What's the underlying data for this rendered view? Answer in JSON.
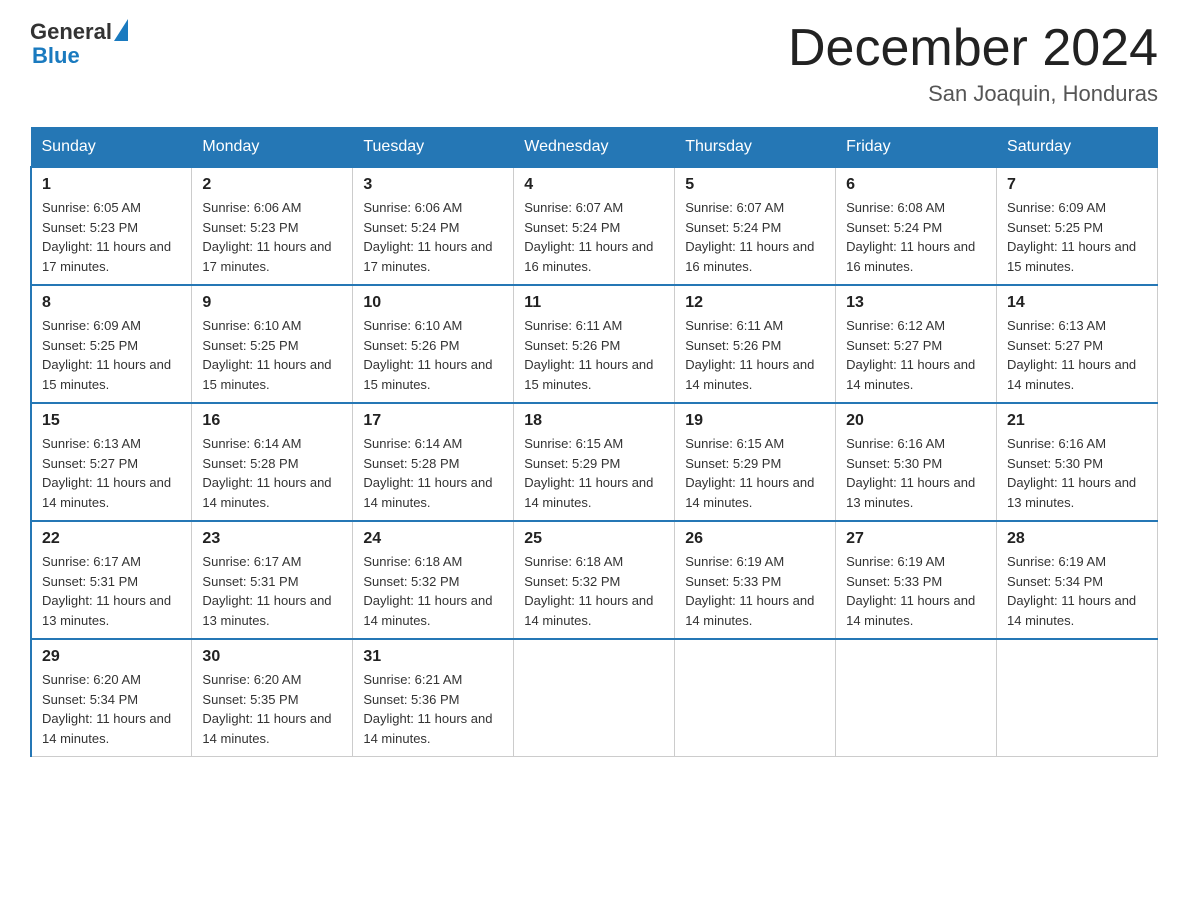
{
  "header": {
    "logo_general": "General",
    "logo_blue": "Blue",
    "title": "December 2024",
    "location": "San Joaquin, Honduras"
  },
  "days_of_week": [
    "Sunday",
    "Monday",
    "Tuesday",
    "Wednesday",
    "Thursday",
    "Friday",
    "Saturday"
  ],
  "weeks": [
    [
      {
        "day": "1",
        "sunrise": "6:05 AM",
        "sunset": "5:23 PM",
        "daylight": "11 hours and 17 minutes."
      },
      {
        "day": "2",
        "sunrise": "6:06 AM",
        "sunset": "5:23 PM",
        "daylight": "11 hours and 17 minutes."
      },
      {
        "day": "3",
        "sunrise": "6:06 AM",
        "sunset": "5:24 PM",
        "daylight": "11 hours and 17 minutes."
      },
      {
        "day": "4",
        "sunrise": "6:07 AM",
        "sunset": "5:24 PM",
        "daylight": "11 hours and 16 minutes."
      },
      {
        "day": "5",
        "sunrise": "6:07 AM",
        "sunset": "5:24 PM",
        "daylight": "11 hours and 16 minutes."
      },
      {
        "day": "6",
        "sunrise": "6:08 AM",
        "sunset": "5:24 PM",
        "daylight": "11 hours and 16 minutes."
      },
      {
        "day": "7",
        "sunrise": "6:09 AM",
        "sunset": "5:25 PM",
        "daylight": "11 hours and 15 minutes."
      }
    ],
    [
      {
        "day": "8",
        "sunrise": "6:09 AM",
        "sunset": "5:25 PM",
        "daylight": "11 hours and 15 minutes."
      },
      {
        "day": "9",
        "sunrise": "6:10 AM",
        "sunset": "5:25 PM",
        "daylight": "11 hours and 15 minutes."
      },
      {
        "day": "10",
        "sunrise": "6:10 AM",
        "sunset": "5:26 PM",
        "daylight": "11 hours and 15 minutes."
      },
      {
        "day": "11",
        "sunrise": "6:11 AM",
        "sunset": "5:26 PM",
        "daylight": "11 hours and 15 minutes."
      },
      {
        "day": "12",
        "sunrise": "6:11 AM",
        "sunset": "5:26 PM",
        "daylight": "11 hours and 14 minutes."
      },
      {
        "day": "13",
        "sunrise": "6:12 AM",
        "sunset": "5:27 PM",
        "daylight": "11 hours and 14 minutes."
      },
      {
        "day": "14",
        "sunrise": "6:13 AM",
        "sunset": "5:27 PM",
        "daylight": "11 hours and 14 minutes."
      }
    ],
    [
      {
        "day": "15",
        "sunrise": "6:13 AM",
        "sunset": "5:27 PM",
        "daylight": "11 hours and 14 minutes."
      },
      {
        "day": "16",
        "sunrise": "6:14 AM",
        "sunset": "5:28 PM",
        "daylight": "11 hours and 14 minutes."
      },
      {
        "day": "17",
        "sunrise": "6:14 AM",
        "sunset": "5:28 PM",
        "daylight": "11 hours and 14 minutes."
      },
      {
        "day": "18",
        "sunrise": "6:15 AM",
        "sunset": "5:29 PM",
        "daylight": "11 hours and 14 minutes."
      },
      {
        "day": "19",
        "sunrise": "6:15 AM",
        "sunset": "5:29 PM",
        "daylight": "11 hours and 14 minutes."
      },
      {
        "day": "20",
        "sunrise": "6:16 AM",
        "sunset": "5:30 PM",
        "daylight": "11 hours and 13 minutes."
      },
      {
        "day": "21",
        "sunrise": "6:16 AM",
        "sunset": "5:30 PM",
        "daylight": "11 hours and 13 minutes."
      }
    ],
    [
      {
        "day": "22",
        "sunrise": "6:17 AM",
        "sunset": "5:31 PM",
        "daylight": "11 hours and 13 minutes."
      },
      {
        "day": "23",
        "sunrise": "6:17 AM",
        "sunset": "5:31 PM",
        "daylight": "11 hours and 13 minutes."
      },
      {
        "day": "24",
        "sunrise": "6:18 AM",
        "sunset": "5:32 PM",
        "daylight": "11 hours and 14 minutes."
      },
      {
        "day": "25",
        "sunrise": "6:18 AM",
        "sunset": "5:32 PM",
        "daylight": "11 hours and 14 minutes."
      },
      {
        "day": "26",
        "sunrise": "6:19 AM",
        "sunset": "5:33 PM",
        "daylight": "11 hours and 14 minutes."
      },
      {
        "day": "27",
        "sunrise": "6:19 AM",
        "sunset": "5:33 PM",
        "daylight": "11 hours and 14 minutes."
      },
      {
        "day": "28",
        "sunrise": "6:19 AM",
        "sunset": "5:34 PM",
        "daylight": "11 hours and 14 minutes."
      }
    ],
    [
      {
        "day": "29",
        "sunrise": "6:20 AM",
        "sunset": "5:34 PM",
        "daylight": "11 hours and 14 minutes."
      },
      {
        "day": "30",
        "sunrise": "6:20 AM",
        "sunset": "5:35 PM",
        "daylight": "11 hours and 14 minutes."
      },
      {
        "day": "31",
        "sunrise": "6:21 AM",
        "sunset": "5:36 PM",
        "daylight": "11 hours and 14 minutes."
      },
      null,
      null,
      null,
      null
    ]
  ],
  "labels": {
    "sunrise": "Sunrise:",
    "sunset": "Sunset:",
    "daylight": "Daylight:"
  }
}
